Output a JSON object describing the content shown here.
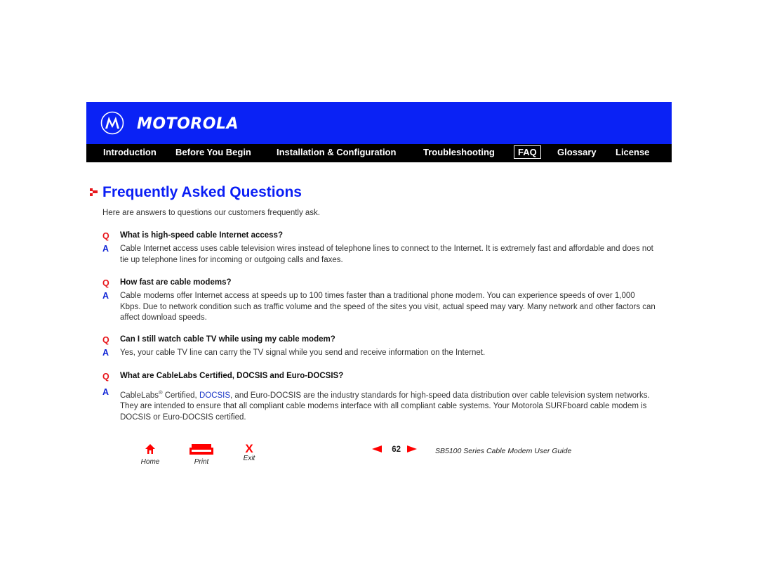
{
  "brand": {
    "name": "MOTOROLA",
    "logo_icon": "motorola-batwing-icon",
    "brand_color": "#0a22f5"
  },
  "nav": {
    "items": [
      {
        "label": "Introduction",
        "active": false
      },
      {
        "label": "Before You Begin",
        "active": false
      },
      {
        "label": "Installation & Configuration",
        "active": false
      },
      {
        "label": "Troubleshooting",
        "active": false
      },
      {
        "label": "FAQ",
        "active": true
      },
      {
        "label": "Glossary",
        "active": false
      },
      {
        "label": "License",
        "active": false
      }
    ]
  },
  "page": {
    "title": "Frequently Asked Questions",
    "title_icon": "red-arrow-bullet-icon",
    "intro": "Here are answers to questions our customers frequently ask.",
    "q_marker": "Q",
    "a_marker": "A",
    "faqs": [
      {
        "question": "What is high-speed cable Internet access?",
        "answer": "Cable Internet access uses cable television wires instead of telephone lines to connect to the Internet. It is extremely fast and affordable and does not tie up telephone lines for incoming or outgoing calls and faxes."
      },
      {
        "question": "How fast are cable modems?",
        "answer": "Cable modems offer Internet access at speeds up to 100 times faster than a traditional phone modem. You can experience speeds of over 1,000 Kbps. Due to network condition such as traffic volume and the speed of the sites you visit, actual speed may vary. Many network and other factors can affect download speeds."
      },
      {
        "question": "Can I still watch cable TV while using my cable modem?",
        "answer": "Yes, your cable TV line can carry the TV signal while you send and receive information on the Internet."
      },
      {
        "question": "What are CableLabs Certified, DOCSIS and Euro-DOCSIS?",
        "answer_parts": {
          "p1": "CableLabs",
          "sup": "®",
          "p2": " Certified, ",
          "link": "DOCSIS",
          "p3": ", and Euro-DOCSIS are the industry standards for high-speed data distribution over cable television system networks. They are intended to ensure that all compliant cable modems interface with all compliant cable systems. Your Motorola SURFboard cable modem is DOCSIS or Euro-DOCSIS certified."
        }
      }
    ]
  },
  "footer": {
    "home_label": "Home",
    "print_label": "Print",
    "exit_label": "Exit",
    "exit_glyph": "X",
    "page_number": "62",
    "guide_title": "SB5100 Series Cable Modem User Guide",
    "icon_color": "#ff0000"
  }
}
